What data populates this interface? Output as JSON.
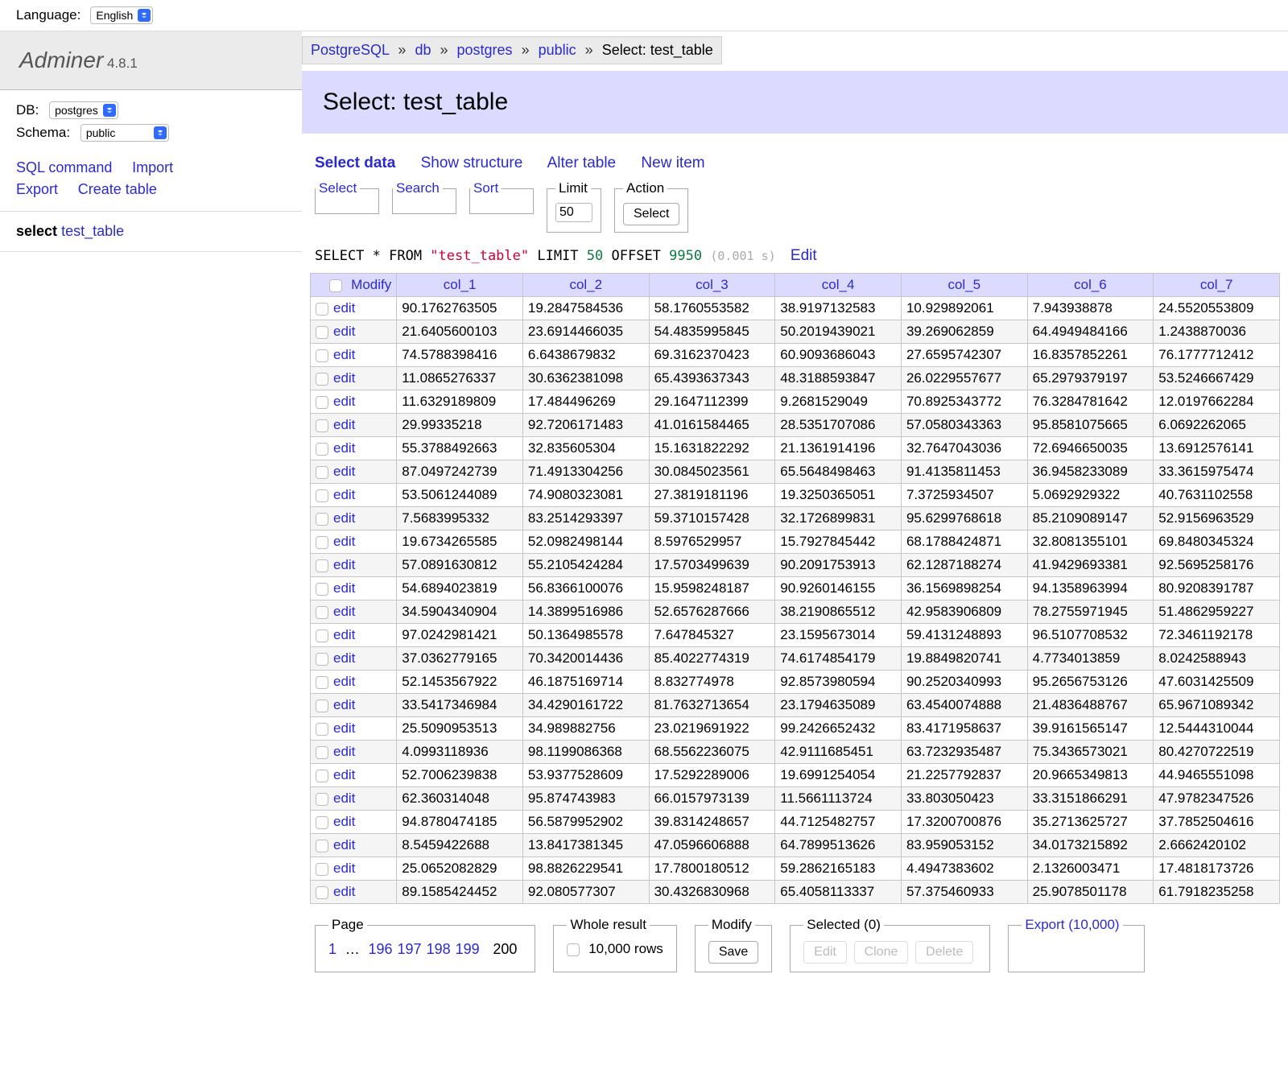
{
  "language": {
    "label": "Language:",
    "value": "English"
  },
  "brand": {
    "name": "Adminer",
    "version": "4.8.1"
  },
  "sidebar": {
    "db_label": "DB:",
    "db_value": "postgres",
    "schema_label": "Schema:",
    "schema_value": "public",
    "links": {
      "sql_command": "SQL command",
      "import": "Import",
      "export": "Export",
      "create_table": "Create table"
    },
    "select_label": "select",
    "select_table": "test_table"
  },
  "breadcrumb": {
    "server": "PostgreSQL",
    "conn": "db",
    "database": "postgres",
    "schema": "public",
    "page": "Select: test_table"
  },
  "page_title": "Select: test_table",
  "toolbar": {
    "select_data": "Select data",
    "show_structure": "Show structure",
    "alter_table": "Alter table",
    "new_item": "New item"
  },
  "fieldsets": {
    "select": "Select",
    "search": "Search",
    "sort": "Sort",
    "limit_label": "Limit",
    "limit_value": "50",
    "action_label": "Action",
    "action_button": "Select"
  },
  "sql": {
    "prefix": "SELECT * FROM ",
    "ident": "\"test_table\"",
    "limit_kw": " LIMIT ",
    "limit_val": "50",
    "offset_kw": " OFFSET ",
    "offset_val": "9950",
    "time": "(0.001 s)",
    "edit": "Edit"
  },
  "table": {
    "modify_header": "Modify",
    "edit_label": "edit",
    "columns": [
      "col_1",
      "col_2",
      "col_3",
      "col_4",
      "col_5",
      "col_6",
      "col_7"
    ],
    "rows": [
      [
        "90.1762763505",
        "19.2847584536",
        "58.1760553582",
        "38.9197132583",
        "10.929892061",
        "7.943938878",
        "24.5520553809"
      ],
      [
        "21.6405600103",
        "23.6914466035",
        "54.4835995845",
        "50.2019439021",
        "39.269062859",
        "64.4949484166",
        "1.2438870036"
      ],
      [
        "74.5788398416",
        "6.6438679832",
        "69.3162370423",
        "60.9093686043",
        "27.6595742307",
        "16.8357852261",
        "76.1777712412"
      ],
      [
        "11.0865276337",
        "30.6362381098",
        "65.4393637343",
        "48.3188593847",
        "26.0229557677",
        "65.2979379197",
        "53.5246667429"
      ],
      [
        "11.6329189809",
        "17.484496269",
        "29.1647112399",
        "9.2681529049",
        "70.8925343772",
        "76.3284781642",
        "12.0197662284"
      ],
      [
        "29.99335218",
        "92.7206171483",
        "41.0161584465",
        "28.5351707086",
        "57.0580343363",
        "95.8581075665",
        "6.0692262065"
      ],
      [
        "55.3788492663",
        "32.835605304",
        "15.1631822292",
        "21.1361914196",
        "32.7647043036",
        "72.6946650035",
        "13.6912576141"
      ],
      [
        "87.0497242739",
        "71.4913304256",
        "30.0845023561",
        "65.5648498463",
        "91.4135811453",
        "36.9458233089",
        "33.3615975474"
      ],
      [
        "53.5061244089",
        "74.9080323081",
        "27.3819181196",
        "19.3250365051",
        "7.3725934507",
        "5.0692929322",
        "40.7631102558"
      ],
      [
        "7.5683995332",
        "83.2514293397",
        "59.3710157428",
        "32.1726899831",
        "95.6299768618",
        "85.2109089147",
        "52.9156963529"
      ],
      [
        "19.6734265585",
        "52.0982498144",
        "8.5976529957",
        "15.7927845442",
        "68.1788424871",
        "32.8081355101",
        "69.8480345324"
      ],
      [
        "57.0891630812",
        "55.2105424284",
        "17.5703499639",
        "90.2091753913",
        "62.1287188274",
        "41.9429693381",
        "92.5695258176"
      ],
      [
        "54.6894023819",
        "56.8366100076",
        "15.9598248187",
        "90.9260146155",
        "36.1569898254",
        "94.1358963994",
        "80.9208391787"
      ],
      [
        "34.5904340904",
        "14.3899516986",
        "52.6576287666",
        "38.2190865512",
        "42.9583906809",
        "78.2755971945",
        "51.4862959227"
      ],
      [
        "97.0242981421",
        "50.1364985578",
        "7.647845327",
        "23.1595673014",
        "59.4131248893",
        "96.5107708532",
        "72.3461192178"
      ],
      [
        "37.0362779165",
        "70.3420014436",
        "85.4022774319",
        "74.6174854179",
        "19.8849820741",
        "4.7734013859",
        "8.0242588943"
      ],
      [
        "52.1453567922",
        "46.1875169714",
        "8.832774978",
        "92.8573980594",
        "90.2520340993",
        "95.2656753126",
        "47.6031425509"
      ],
      [
        "33.5417346984",
        "34.4290161722",
        "81.7632713654",
        "23.1794635089",
        "63.4540074888",
        "21.4836488767",
        "65.9671089342"
      ],
      [
        "25.5090953513",
        "34.989882756",
        "23.0219691922",
        "99.2426652432",
        "83.4171958637",
        "39.9161565147",
        "12.5444310044"
      ],
      [
        "4.0993118936",
        "98.1199086368",
        "68.5562236075",
        "42.9111685451",
        "63.7232935487",
        "75.3436573021",
        "80.4270722519"
      ],
      [
        "52.7006239838",
        "53.9377528609",
        "17.5292289006",
        "19.6991254054",
        "21.2257792837",
        "20.9665349813",
        "44.9465551098"
      ],
      [
        "62.360314048",
        "95.874743983",
        "66.0157973139",
        "11.5661113724",
        "33.803050423",
        "33.3151866291",
        "47.9782347526"
      ],
      [
        "94.8780474185",
        "56.5879952902",
        "39.8314248657",
        "44.7125482757",
        "17.3200700876",
        "35.2713625727",
        "37.7852504616"
      ],
      [
        "8.5459422688",
        "13.8417381345",
        "47.0596606888",
        "64.7899513626",
        "83.959053152",
        "34.0173215892",
        "2.6662420102"
      ],
      [
        "25.0652082829",
        "98.8826229541",
        "17.7800180512",
        "59.2862165183",
        "4.4947383602",
        "2.1326003471",
        "17.4818173726"
      ],
      [
        "89.1585424452",
        "92.080577307",
        "30.4326830968",
        "65.4058113337",
        "57.375460933",
        "25.9078501178",
        "61.7918235258"
      ]
    ]
  },
  "bottom": {
    "page_label": "Page",
    "pages": {
      "first": "1",
      "ellipsis": "…",
      "links": [
        "196",
        "197",
        "198",
        "199"
      ],
      "current": "200"
    },
    "whole_label": "Whole result",
    "whole_text": "10,000 rows",
    "modify_label": "Modify",
    "save": "Save",
    "selected_label": "Selected (0)",
    "edit": "Edit",
    "clone": "Clone",
    "delete": "Delete",
    "export_label": "Export (10,000)"
  }
}
